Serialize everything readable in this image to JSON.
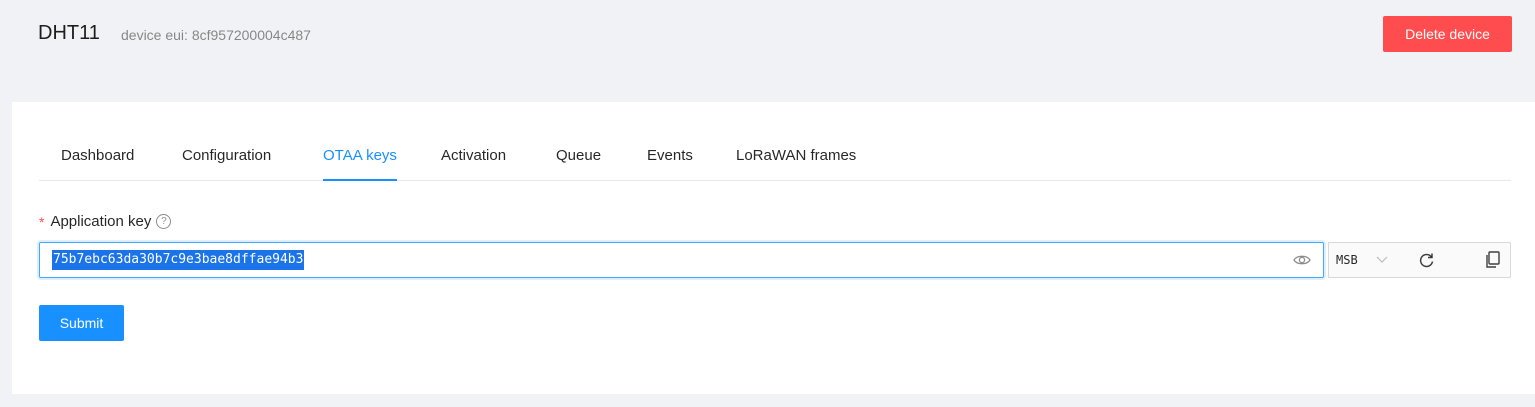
{
  "header": {
    "device_name": "DHT11",
    "device_eui": "device eui: 8cf957200004c487",
    "delete_label": "Delete device"
  },
  "tabs": [
    {
      "label": "Dashboard",
      "active": false
    },
    {
      "label": "Configuration",
      "active": false
    },
    {
      "label": "OTAA keys",
      "active": true
    },
    {
      "label": "Activation",
      "active": false
    },
    {
      "label": "Queue",
      "active": false
    },
    {
      "label": "Events",
      "active": false
    },
    {
      "label": "LoRaWAN frames",
      "active": false
    }
  ],
  "form": {
    "required_mark": "*",
    "app_key_label": "Application key",
    "app_key_value": "75b7ebc63da30b7c9e3bae8dffae94b3",
    "byte_order": "MSB",
    "submit_label": "Submit"
  },
  "icons": {
    "help": "question-circle-icon",
    "visibility": "eye-icon",
    "dropdown": "chevron-down-icon",
    "refresh": "refresh-icon",
    "copy": "copy-icon"
  },
  "colors": {
    "primary": "#1890ff",
    "danger": "#ff4d4f",
    "selection": "#1a73e8",
    "background": "#f0f2f5"
  }
}
